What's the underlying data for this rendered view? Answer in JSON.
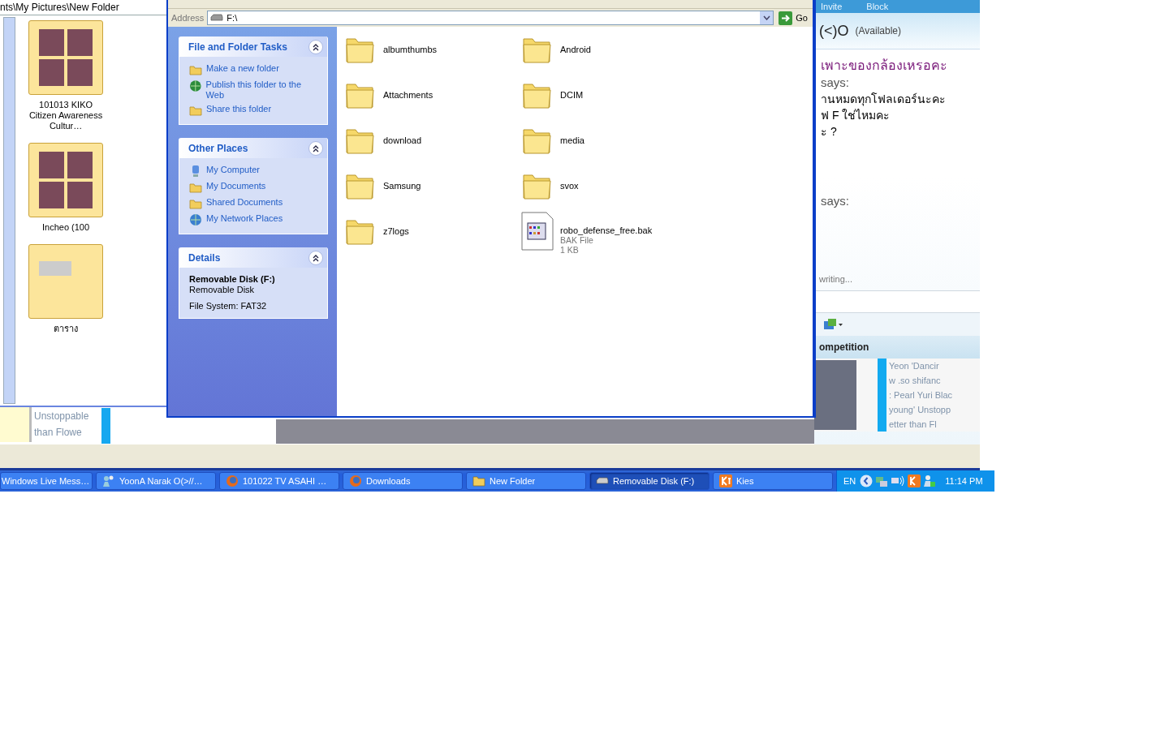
{
  "back_window": {
    "path": "nts\\My Pictures\\New Folder",
    "items": [
      {
        "name": "101013 KIKO Citizen Awareness Cultur…",
        "kind": "photos"
      },
      {
        "name": "Incheo (100",
        "kind": "photos"
      },
      {
        "name": "ตาราง",
        "kind": "table"
      }
    ]
  },
  "explorer": {
    "address_label": "Address",
    "address": "F:\\",
    "go": "Go",
    "panels": [
      {
        "title": "File and Folder Tasks",
        "expanded": true,
        "kind": "links",
        "items": [
          {
            "label": "Make a new folder"
          },
          {
            "label": "Publish this folder to the Web"
          },
          {
            "label": "Share this folder"
          }
        ]
      },
      {
        "title": "Other Places",
        "expanded": true,
        "kind": "places",
        "items": [
          {
            "label": "My Computer"
          },
          {
            "label": "My Documents"
          },
          {
            "label": "Shared Documents"
          },
          {
            "label": "My Network Places"
          }
        ]
      },
      {
        "title": "Details",
        "expanded": true,
        "kind": "details",
        "name": "Removable Disk (F:)",
        "lines": [
          "Removable Disk",
          "File System: FAT32"
        ]
      }
    ],
    "files": [
      {
        "name": "albumthumbs",
        "kind": "folder"
      },
      {
        "name": "Android",
        "kind": "folder"
      },
      {
        "name": "Attachments",
        "kind": "folder"
      },
      {
        "name": "DCIM",
        "kind": "folder"
      },
      {
        "name": "download",
        "kind": "folder"
      },
      {
        "name": "media",
        "kind": "folder"
      },
      {
        "name": "Samsung",
        "kind": "folder"
      },
      {
        "name": "svox",
        "kind": "folder"
      },
      {
        "name": "z7logs",
        "kind": "folder"
      },
      {
        "name": "robo_defense_free.bak",
        "kind": "file",
        "type": "BAK File",
        "size": "1 KB"
      }
    ]
  },
  "messenger": {
    "menu": [
      "Invite",
      "Block"
    ],
    "contact": "(<)O",
    "status": "(Available)",
    "messages": [
      {
        "text": "เพาะของกล้องเหรอคะ",
        "kind": "highlight"
      },
      {
        "text": "says:",
        "kind": "sender"
      },
      {
        "text": "านหมดทุกโฟลเดอร์นะคะ",
        "kind": "line"
      },
      {
        "text": "ฟ F ใช่ไหมคะ",
        "kind": "line"
      },
      {
        "text": "ะ ?",
        "kind": "line"
      },
      {
        "text": "says:",
        "kind": "sender"
      }
    ],
    "typing": "writing...",
    "ad_title": "ompetition",
    "ad_lines": [
      "Yeon 'Dancir",
      "w .so shifanc",
      ": Pearl Yuri Blac",
      "young' Unstopp",
      "etter  than Fl"
    ],
    "back_lines": [
      "Unstoppable",
      "than Flowe"
    ]
  },
  "taskbar": {
    "buttons": [
      {
        "label": "Windows Live Mess…",
        "selected": false
      },
      {
        "label": "YoonA Narak O(>//…",
        "selected": false
      },
      {
        "label": "101022 TV ASAHI …",
        "selected": false
      },
      {
        "label": "Downloads",
        "selected": false
      },
      {
        "label": "New Folder",
        "selected": false
      },
      {
        "label": "Removable Disk (F:)",
        "selected": true
      },
      {
        "label": "Kies",
        "selected": false
      }
    ],
    "language": "EN",
    "clock": "11:14 PM"
  }
}
